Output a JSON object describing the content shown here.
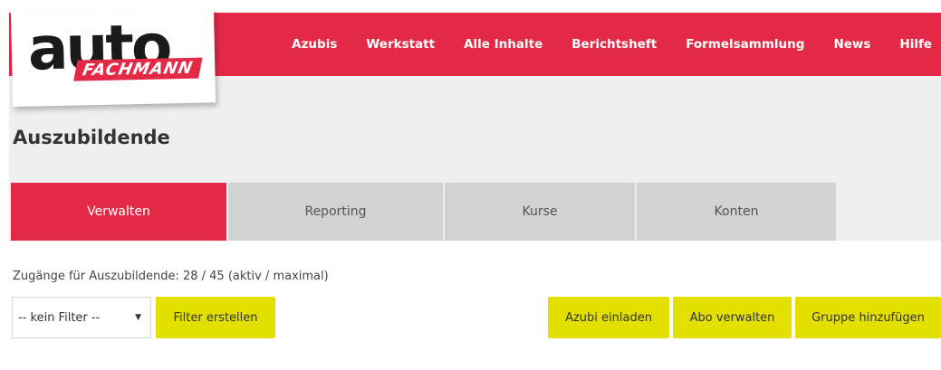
{
  "brand": {
    "logo_word": "auto",
    "logo_sub": "FACHMANN",
    "primary_color": "#e32945",
    "button_color": "#e3e000"
  },
  "nav": {
    "items": [
      {
        "label": "Azubis"
      },
      {
        "label": "Werkstatt"
      },
      {
        "label": "Alle Inhalte"
      },
      {
        "label": "Berichtsheft"
      },
      {
        "label": "Formelsammlung"
      },
      {
        "label": "News"
      },
      {
        "label": "Hilfe"
      }
    ]
  },
  "page": {
    "title": "Auszubildende"
  },
  "tabs": [
    {
      "label": "Verwalten",
      "active": true
    },
    {
      "label": "Reporting",
      "active": false
    },
    {
      "label": "Kurse",
      "active": false
    },
    {
      "label": "Konten",
      "active": false
    }
  ],
  "quota": {
    "text": "Zugänge für Auszubildende: 28 / 45 (aktiv / maximal)"
  },
  "toolbar": {
    "filter_select_value": "-- kein Filter --",
    "filter_caret_icon": "caret-down-icon",
    "create_filter_label": "Filter erstellen",
    "invite_label": "Azubi einladen",
    "manage_subscription_label": "Abo verwalten",
    "add_group_label": "Gruppe hinzufügen"
  }
}
